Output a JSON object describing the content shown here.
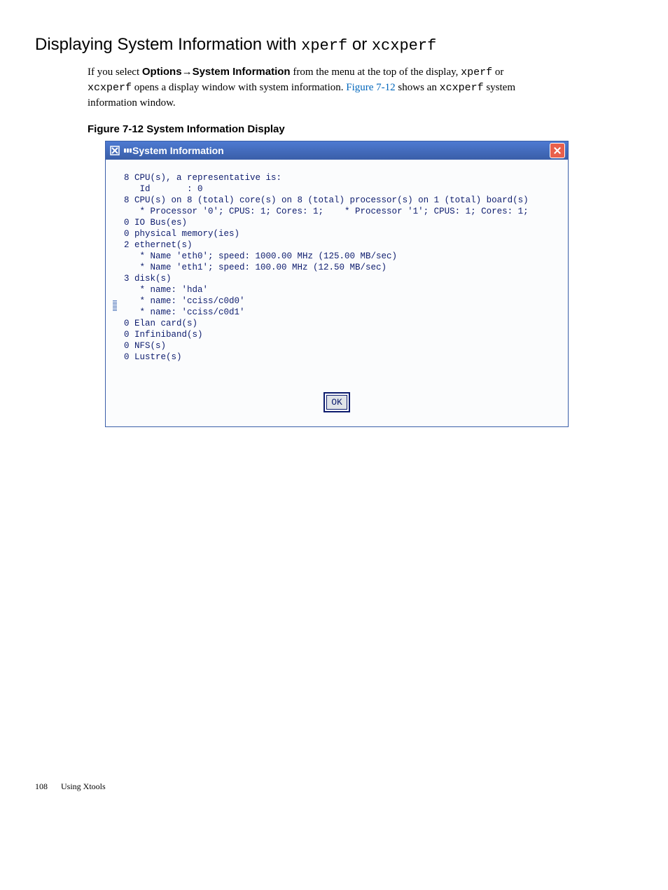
{
  "heading": {
    "prefix": "Displaying System Information with ",
    "tool1": "xperf",
    "or": " or ",
    "tool2": "xcxperf"
  },
  "paragraph": {
    "part1": "If you select ",
    "menu1": "Options",
    "arrow": "→",
    "menu2": "System Information",
    "part2": " from the menu at the top of the display, ",
    "tool1": "xperf",
    "part3": " or ",
    "tool2": "xcxperf",
    "part4": " opens a display window with system information. ",
    "figlink": "Figure 7-12",
    "part5": " shows an ",
    "tool3": "xcxperf",
    "part6": " system information window."
  },
  "figure_caption": "Figure  7-12  System Information Display",
  "dialog": {
    "title": "System Information",
    "body": "8 CPU(s), a representative is:\n   Id       : 0\n8 CPU(s) on 8 (total) core(s) on 8 (total) processor(s) on 1 (total) board(s)\n   * Processor '0'; CPUS: 1; Cores: 1;    * Processor '1'; CPUS: 1; Cores: 1;\n0 IO Bus(es)\n0 physical memory(ies)\n2 ethernet(s)\n   * Name 'eth0'; speed: 1000.00 MHz (125.00 MB/sec)\n   * Name 'eth1'; speed: 100.00 MHz (12.50 MB/sec)\n3 disk(s)\n   * name: 'hda'\n   * name: 'cciss/c0d0'\n   * name: 'cciss/c0d1'\n0 Elan card(s)\n0 Infiniband(s)\n0 NFS(s)\n0 Lustre(s)",
    "ok_label": "OK"
  },
  "footer": {
    "page": "108",
    "chapter": "Using Xtools"
  }
}
